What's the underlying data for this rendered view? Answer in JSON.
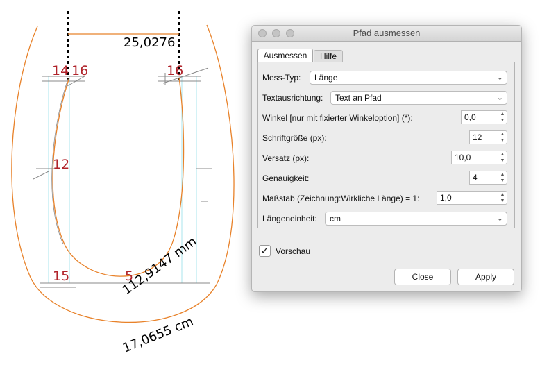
{
  "drawing": {
    "labels": {
      "n14": "14",
      "n16a": "16",
      "n16b": "16",
      "n12": "12",
      "n15": "15",
      "n5": "5"
    },
    "measurements": {
      "top": "25,0276",
      "inner": "112,9147 mm",
      "outer": "17,0655 cm"
    }
  },
  "dialog": {
    "title": "Pfad ausmessen",
    "tabs": [
      "Ausmessen",
      "Hilfe"
    ],
    "fields": {
      "mess_typ": {
        "label": "Mess-Typ:",
        "value": "Länge"
      },
      "textausrichtung": {
        "label": "Textausrichtung:",
        "value": "Text an Pfad"
      },
      "winkel": {
        "label": "Winkel [nur mit fixierter Winkeloption] (*):",
        "value": "0,0"
      },
      "schriftgroesse": {
        "label": "Schriftgröße (px):",
        "value": "12"
      },
      "versatz": {
        "label": "Versatz (px):",
        "value": "10,0"
      },
      "genauigkeit": {
        "label": "Genauigkeit:",
        "value": "4"
      },
      "massstab": {
        "label": "Maßstab (Zeichnung:Wirkliche Länge) = 1:",
        "value": "1,0"
      },
      "laengeneinheit": {
        "label": "Längeneinheit:",
        "value": "cm"
      }
    },
    "preview": {
      "label": "Vorschau",
      "checked": true,
      "mark": "✓"
    },
    "buttons": {
      "close": "Close",
      "apply": "Apply"
    }
  },
  "icons": {
    "chevron": "chevron-down-icon",
    "spin_up": "arrow-up-icon",
    "spin_down": "arrow-down-icon",
    "check": "checkmark-icon"
  },
  "colors": {
    "curve": "#e8822a",
    "label_red": "#b0232a",
    "helper": "#a9e4ee"
  }
}
